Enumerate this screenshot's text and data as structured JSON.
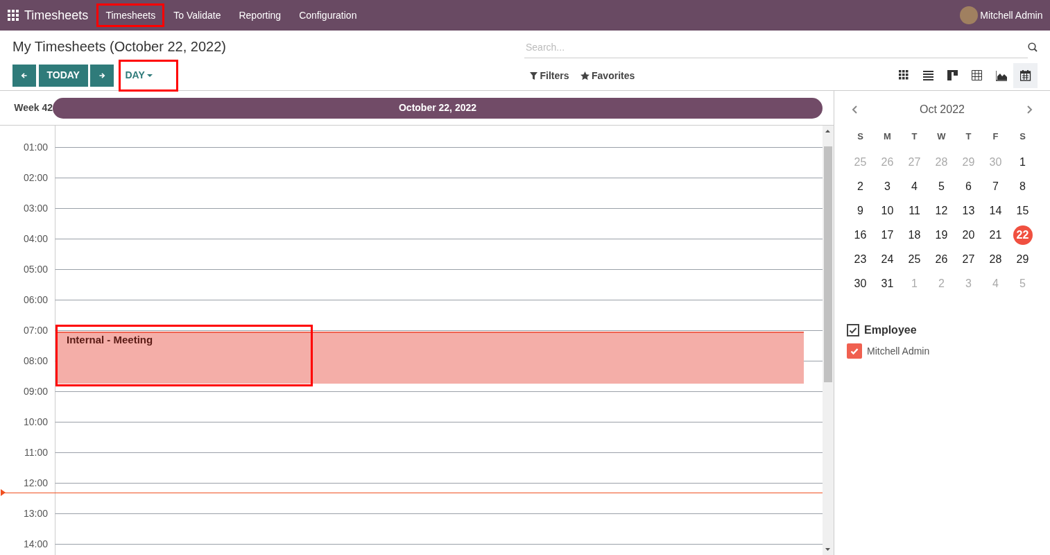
{
  "navbar": {
    "app_name": "Timesheets",
    "menu": [
      {
        "label": "Timesheets",
        "highlighted": true
      },
      {
        "label": "To Validate",
        "highlighted": false
      },
      {
        "label": "Reporting",
        "highlighted": false
      },
      {
        "label": "Configuration",
        "highlighted": false
      }
    ],
    "user": "Mitchell Admin"
  },
  "control_panel": {
    "title": "My Timesheets (October 22, 2022)",
    "today": "TODAY",
    "scale": {
      "label": "DAY",
      "highlighted": true
    },
    "search": {
      "placeholder": "Search..."
    },
    "filters": "Filters",
    "favorites": "Favorites",
    "views": [
      {
        "kind": "kanban",
        "selected": false
      },
      {
        "kind": "list",
        "selected": false
      },
      {
        "kind": "gantt",
        "selected": false
      },
      {
        "kind": "pivot",
        "selected": false
      },
      {
        "kind": "graph",
        "selected": false
      },
      {
        "kind": "calendar",
        "selected": true
      }
    ]
  },
  "calendar": {
    "week": "Week 42",
    "day": "October 22, 2022",
    "hours": [
      {
        "label": "01:00",
        "current_time": false
      },
      {
        "label": "02:00",
        "current_time": false
      },
      {
        "label": "03:00",
        "current_time": false
      },
      {
        "label": "04:00",
        "current_time": false
      },
      {
        "label": "05:00",
        "current_time": false
      },
      {
        "label": "06:00",
        "current_time": false
      },
      {
        "label": "07:00",
        "current_time": false,
        "event": {
          "title": "Internal - Meeting",
          "highlighted": true
        }
      },
      {
        "label": "08:00",
        "current_time": false
      },
      {
        "label": "09:00",
        "current_time": false
      },
      {
        "label": "10:00",
        "current_time": false
      },
      {
        "label": "11:00",
        "current_time": false
      },
      {
        "label": "12:00",
        "current_time": true
      },
      {
        "label": "13:00",
        "current_time": false
      },
      {
        "label": "14:00",
        "current_time": false
      }
    ]
  },
  "sidebar": {
    "month": "Oct 2022",
    "weekdays": [
      "S",
      "M",
      "T",
      "W",
      "T",
      "F",
      "S"
    ],
    "weeks": [
      [
        {
          "d": "25",
          "muted": true,
          "selected": false
        },
        {
          "d": "26",
          "muted": true,
          "selected": false
        },
        {
          "d": "27",
          "muted": true,
          "selected": false
        },
        {
          "d": "28",
          "muted": true,
          "selected": false
        },
        {
          "d": "29",
          "muted": true,
          "selected": false
        },
        {
          "d": "30",
          "muted": true,
          "selected": false
        },
        {
          "d": "1",
          "muted": false,
          "selected": false
        }
      ],
      [
        {
          "d": "2",
          "muted": false,
          "selected": false
        },
        {
          "d": "3",
          "muted": false,
          "selected": false
        },
        {
          "d": "4",
          "muted": false,
          "selected": false
        },
        {
          "d": "5",
          "muted": false,
          "selected": false
        },
        {
          "d": "6",
          "muted": false,
          "selected": false
        },
        {
          "d": "7",
          "muted": false,
          "selected": false
        },
        {
          "d": "8",
          "muted": false,
          "selected": false
        }
      ],
      [
        {
          "d": "9",
          "muted": false,
          "selected": false
        },
        {
          "d": "10",
          "muted": false,
          "selected": false
        },
        {
          "d": "11",
          "muted": false,
          "selected": false
        },
        {
          "d": "12",
          "muted": false,
          "selected": false
        },
        {
          "d": "13",
          "muted": false,
          "selected": false
        },
        {
          "d": "14",
          "muted": false,
          "selected": false
        },
        {
          "d": "15",
          "muted": false,
          "selected": false
        }
      ],
      [
        {
          "d": "16",
          "muted": false,
          "selected": false
        },
        {
          "d": "17",
          "muted": false,
          "selected": false
        },
        {
          "d": "18",
          "muted": false,
          "selected": false
        },
        {
          "d": "19",
          "muted": false,
          "selected": false
        },
        {
          "d": "20",
          "muted": false,
          "selected": false
        },
        {
          "d": "21",
          "muted": false,
          "selected": false
        },
        {
          "d": "22",
          "muted": false,
          "selected": true
        }
      ],
      [
        {
          "d": "23",
          "muted": false,
          "selected": false
        },
        {
          "d": "24",
          "muted": false,
          "selected": false
        },
        {
          "d": "25",
          "muted": false,
          "selected": false
        },
        {
          "d": "26",
          "muted": false,
          "selected": false
        },
        {
          "d": "27",
          "muted": false,
          "selected": false
        },
        {
          "d": "28",
          "muted": false,
          "selected": false
        },
        {
          "d": "29",
          "muted": false,
          "selected": false
        }
      ],
      [
        {
          "d": "30",
          "muted": false,
          "selected": false
        },
        {
          "d": "31",
          "muted": false,
          "selected": false
        },
        {
          "d": "1",
          "muted": true,
          "selected": false
        },
        {
          "d": "2",
          "muted": true,
          "selected": false
        },
        {
          "d": "3",
          "muted": true,
          "selected": false
        },
        {
          "d": "4",
          "muted": true,
          "selected": false
        },
        {
          "d": "5",
          "muted": true,
          "selected": false
        }
      ]
    ],
    "filter_group": {
      "label": "Employee",
      "checked": true
    },
    "filters": [
      {
        "label": "Mitchell Admin",
        "checked": true,
        "color": "#f06050"
      }
    ]
  }
}
